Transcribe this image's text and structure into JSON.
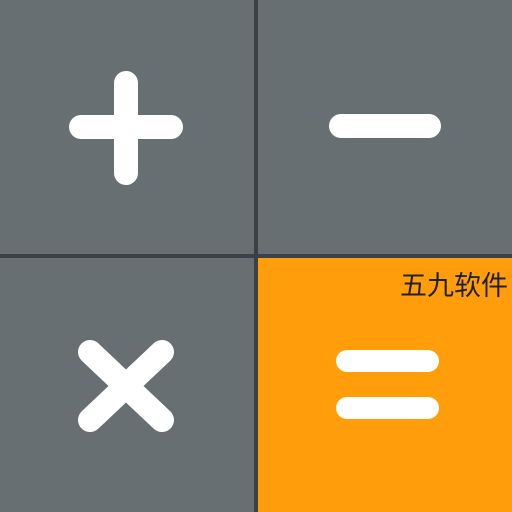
{
  "colors": {
    "divider": "#3c4144",
    "key_gray": "#676f73",
    "key_accent": "#ff9e0a",
    "glyph": "#ffffff",
    "watermark_text": "#222222"
  },
  "keys": [
    {
      "id": "plus",
      "icon": "plus-icon",
      "style": "gray"
    },
    {
      "id": "minus",
      "icon": "minus-icon",
      "style": "gray"
    },
    {
      "id": "times",
      "icon": "times-icon",
      "style": "gray"
    },
    {
      "id": "equals",
      "icon": "equals-icon",
      "style": "accent"
    }
  ],
  "watermark": {
    "text": "五九软件"
  }
}
